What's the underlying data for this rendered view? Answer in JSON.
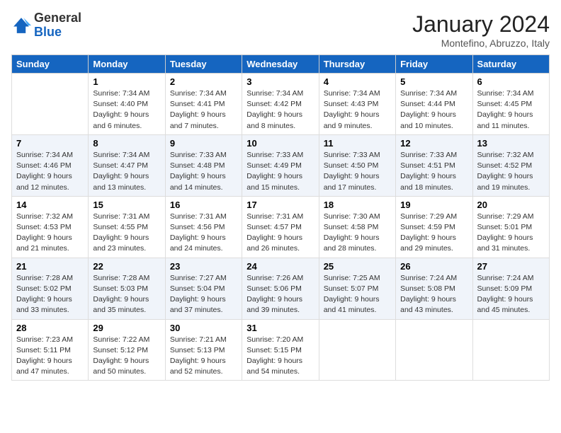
{
  "header": {
    "logo_general": "General",
    "logo_blue": "Blue",
    "month_title": "January 2024",
    "location": "Montefino, Abruzzo, Italy"
  },
  "days_of_week": [
    "Sunday",
    "Monday",
    "Tuesday",
    "Wednesday",
    "Thursday",
    "Friday",
    "Saturday"
  ],
  "weeks": [
    [
      {
        "day": "",
        "info": ""
      },
      {
        "day": "1",
        "info": "Sunrise: 7:34 AM\nSunset: 4:40 PM\nDaylight: 9 hours\nand 6 minutes."
      },
      {
        "day": "2",
        "info": "Sunrise: 7:34 AM\nSunset: 4:41 PM\nDaylight: 9 hours\nand 7 minutes."
      },
      {
        "day": "3",
        "info": "Sunrise: 7:34 AM\nSunset: 4:42 PM\nDaylight: 9 hours\nand 8 minutes."
      },
      {
        "day": "4",
        "info": "Sunrise: 7:34 AM\nSunset: 4:43 PM\nDaylight: 9 hours\nand 9 minutes."
      },
      {
        "day": "5",
        "info": "Sunrise: 7:34 AM\nSunset: 4:44 PM\nDaylight: 9 hours\nand 10 minutes."
      },
      {
        "day": "6",
        "info": "Sunrise: 7:34 AM\nSunset: 4:45 PM\nDaylight: 9 hours\nand 11 minutes."
      }
    ],
    [
      {
        "day": "7",
        "info": "Sunrise: 7:34 AM\nSunset: 4:46 PM\nDaylight: 9 hours\nand 12 minutes."
      },
      {
        "day": "8",
        "info": "Sunrise: 7:34 AM\nSunset: 4:47 PM\nDaylight: 9 hours\nand 13 minutes."
      },
      {
        "day": "9",
        "info": "Sunrise: 7:33 AM\nSunset: 4:48 PM\nDaylight: 9 hours\nand 14 minutes."
      },
      {
        "day": "10",
        "info": "Sunrise: 7:33 AM\nSunset: 4:49 PM\nDaylight: 9 hours\nand 15 minutes."
      },
      {
        "day": "11",
        "info": "Sunrise: 7:33 AM\nSunset: 4:50 PM\nDaylight: 9 hours\nand 17 minutes."
      },
      {
        "day": "12",
        "info": "Sunrise: 7:33 AM\nSunset: 4:51 PM\nDaylight: 9 hours\nand 18 minutes."
      },
      {
        "day": "13",
        "info": "Sunrise: 7:32 AM\nSunset: 4:52 PM\nDaylight: 9 hours\nand 19 minutes."
      }
    ],
    [
      {
        "day": "14",
        "info": "Sunrise: 7:32 AM\nSunset: 4:53 PM\nDaylight: 9 hours\nand 21 minutes."
      },
      {
        "day": "15",
        "info": "Sunrise: 7:31 AM\nSunset: 4:55 PM\nDaylight: 9 hours\nand 23 minutes."
      },
      {
        "day": "16",
        "info": "Sunrise: 7:31 AM\nSunset: 4:56 PM\nDaylight: 9 hours\nand 24 minutes."
      },
      {
        "day": "17",
        "info": "Sunrise: 7:31 AM\nSunset: 4:57 PM\nDaylight: 9 hours\nand 26 minutes."
      },
      {
        "day": "18",
        "info": "Sunrise: 7:30 AM\nSunset: 4:58 PM\nDaylight: 9 hours\nand 28 minutes."
      },
      {
        "day": "19",
        "info": "Sunrise: 7:29 AM\nSunset: 4:59 PM\nDaylight: 9 hours\nand 29 minutes."
      },
      {
        "day": "20",
        "info": "Sunrise: 7:29 AM\nSunset: 5:01 PM\nDaylight: 9 hours\nand 31 minutes."
      }
    ],
    [
      {
        "day": "21",
        "info": "Sunrise: 7:28 AM\nSunset: 5:02 PM\nDaylight: 9 hours\nand 33 minutes."
      },
      {
        "day": "22",
        "info": "Sunrise: 7:28 AM\nSunset: 5:03 PM\nDaylight: 9 hours\nand 35 minutes."
      },
      {
        "day": "23",
        "info": "Sunrise: 7:27 AM\nSunset: 5:04 PM\nDaylight: 9 hours\nand 37 minutes."
      },
      {
        "day": "24",
        "info": "Sunrise: 7:26 AM\nSunset: 5:06 PM\nDaylight: 9 hours\nand 39 minutes."
      },
      {
        "day": "25",
        "info": "Sunrise: 7:25 AM\nSunset: 5:07 PM\nDaylight: 9 hours\nand 41 minutes."
      },
      {
        "day": "26",
        "info": "Sunrise: 7:24 AM\nSunset: 5:08 PM\nDaylight: 9 hours\nand 43 minutes."
      },
      {
        "day": "27",
        "info": "Sunrise: 7:24 AM\nSunset: 5:09 PM\nDaylight: 9 hours\nand 45 minutes."
      }
    ],
    [
      {
        "day": "28",
        "info": "Sunrise: 7:23 AM\nSunset: 5:11 PM\nDaylight: 9 hours\nand 47 minutes."
      },
      {
        "day": "29",
        "info": "Sunrise: 7:22 AM\nSunset: 5:12 PM\nDaylight: 9 hours\nand 50 minutes."
      },
      {
        "day": "30",
        "info": "Sunrise: 7:21 AM\nSunset: 5:13 PM\nDaylight: 9 hours\nand 52 minutes."
      },
      {
        "day": "31",
        "info": "Sunrise: 7:20 AM\nSunset: 5:15 PM\nDaylight: 9 hours\nand 54 minutes."
      },
      {
        "day": "",
        "info": ""
      },
      {
        "day": "",
        "info": ""
      },
      {
        "day": "",
        "info": ""
      }
    ]
  ]
}
